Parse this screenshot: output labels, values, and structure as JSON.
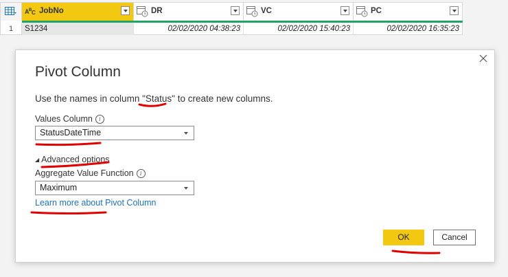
{
  "table": {
    "row_number": "1",
    "columns": [
      {
        "name": "JobNo",
        "type_icon": "text-type-icon",
        "selected": true
      },
      {
        "name": "DR",
        "type_icon": "datetime-type-icon",
        "selected": false
      },
      {
        "name": "VC",
        "type_icon": "datetime-type-icon",
        "selected": false
      },
      {
        "name": "PC",
        "type_icon": "datetime-type-icon",
        "selected": false
      }
    ],
    "rows": [
      [
        "S1234",
        "02/02/2020 04:38:23",
        "02/02/2020 15:40:23",
        "02/02/2020 16:35:23"
      ]
    ]
  },
  "dialog": {
    "title": "Pivot Column",
    "description_prefix": "Use the names in column \"",
    "description_column": "Status",
    "description_suffix": "\" to create new columns.",
    "values_column": {
      "label": "Values Column",
      "selected": "StatusDateTime"
    },
    "advanced_options_label": "Advanced options",
    "aggregate": {
      "label": "Aggregate Value Function",
      "selected": "Maximum"
    },
    "learn_more_link": "Learn more about Pivot Column",
    "ok_label": "OK",
    "cancel_label": "Cancel"
  },
  "colors": {
    "accent_yellow": "#f2c811",
    "quality_bar": "#21a366",
    "link": "#1a73c6",
    "annotation_red": "#e00000"
  }
}
